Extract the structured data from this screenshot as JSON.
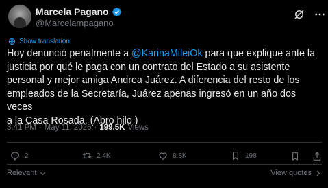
{
  "author": {
    "display_name": "Marcela Pagano",
    "handle": "@Marcelampagano",
    "verified_icon": "verified-badge-icon"
  },
  "translation": {
    "label": "Show translation"
  },
  "tweet": {
    "text_before": "Hoy denunció penalmente a ",
    "mention": "@KarinaMileiOk",
    "text_after": " para que explique ante la\njusticia por qué le paga con un contrato del Estado a su asistente\npersonal y mejor amiga Andrea Juárez. A diferencia del resto de los\nempleados de la Secretaría, Juárez apenas ingresó en un año dos veces\na la Casa Rosada.  (Abro hilo      )"
  },
  "meta": {
    "time": "3:41 PM",
    "separator": "·",
    "date": "May 11, 2026",
    "views_count": "199.5K",
    "views_label": "Views"
  },
  "actions": {
    "replies": "2",
    "reposts": "2.4K",
    "likes": "8.8K",
    "bookmarks": "198"
  },
  "footer": {
    "sort_label": "Relevant",
    "quotes_label": "View quotes"
  },
  "colors": {
    "background": "#000000",
    "text": "#e7e9ea",
    "muted": "#71767b",
    "accent": "#1d9bf0",
    "divider": "#2f3336"
  }
}
